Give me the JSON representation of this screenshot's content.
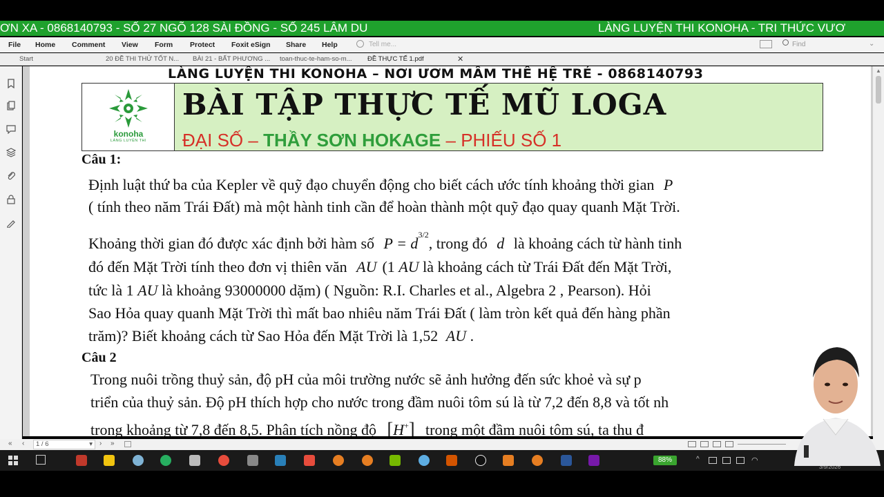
{
  "banner": {
    "left_text": "ƠN XA - 0868140793 - SỐ 27 NGÕ 128 SÀI ĐỒNG - SỐ 245 LÂM DU",
    "right_text": "LÀNG LUYỆN THI KONOHA - TRI THỨC VƯƠ"
  },
  "menu": {
    "items": [
      "File",
      "Home",
      "Comment",
      "View",
      "Form",
      "Protect",
      "Foxit eSign",
      "Share",
      "Help"
    ],
    "tell_me": "Tell me...",
    "find_placeholder": "Find"
  },
  "tabs": {
    "start": "Start",
    "items": [
      "20 ĐỀ THI THỬ TỐT N...",
      "BÀI 21 - BẤT PHƯƠNG ...",
      "toan-thuc-te-ham-so-m...",
      "ĐỀ THỰC TẾ 1.pdf"
    ]
  },
  "document": {
    "header_line": "LÀNG LUYỆN THI KONOHA – NƠI ƯƠM MẦM THẾ HỆ TRẺ - 0868140793",
    "logo_name": "konoha",
    "logo_tagline": "LÀNG LUYỆN THI",
    "title": "BÀI TẬP THỰC TẾ MŨ LOGA",
    "subtitle_1": "ĐẠI SỐ",
    "subtitle_dash": "–",
    "subtitle_2": "THẦY SƠN HOKAGE",
    "subtitle_3": "PHIẾU SỐ 1",
    "q1_label": "Câu 1:",
    "q1_lines": [
      "Định luật thứ ba của Kepler về quỹ đạo chuyển động cho biết cách ước tính khoảng thời gian",
      "( tính theo năm Trái Đất) mà một hành tinh cần để hoàn thành một quỹ đạo quay quanh Mặt Trời.",
      "Khoảng thời gian đó được xác định bởi hàm số",
      ", trong đó",
      "là khoảng cách từ hành tinh",
      "đó đến Mặt Trời tính theo đơn vị thiên văn",
      "là khoảng cách từ Trái Đất đến Mặt Trời,",
      "tức là 1",
      "là khoảng  93000000  dặm) ( Nguồn: R.I. Charles et al., Algebra  2 , Pearson). Hỏi",
      "Sao Hỏa quay quanh Mặt Trời thì mất bao nhiêu năm Trái Đất ( làm tròn kết quả đến hàng phần",
      "trăm)? Biết khoảng cách từ Sao Hỏa đến Mặt Trời là 1,52"
    ],
    "q2_label": "Câu 2",
    "q2_lines": [
      "Trong nuôi trồng thuỷ sản, độ pH của môi trường nước sẽ ảnh hưởng đến sức khoẻ và sự p",
      "triển của thuỷ sản. Độ pH thích hợp cho nước trong đầm nuôi tôm sú là từ 7,2 đến 8,8 và tốt nh",
      "trong khoảng từ 7,8 đến 8,5. Phân tích nồng độ",
      "trong một đầm nuôi tôm sú, ta thu đ"
    ]
  },
  "pager": {
    "page_label": "1 / 6"
  },
  "taskbar": {
    "battery": "88%"
  },
  "clock": {
    "date": "3/9/2026"
  }
}
